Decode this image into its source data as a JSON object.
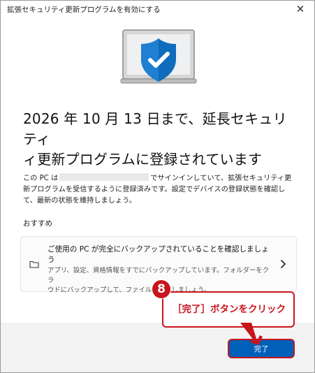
{
  "window": {
    "title": "拡張セキュリティ更新プログラムを有効にする",
    "close_glyph": "✕"
  },
  "headline": {
    "line1": "2026 年 10 月 13 日まで、延長セキュリティ",
    "line2": "ィ更新プログラムに登録されています"
  },
  "body": {
    "line1_prefix": "この PC は",
    "line1_suffix": "でサインインしていて、拡張セキュリティ更",
    "line2": "新プログラムを受信するように登録済みです。設定でデバイスの登録状態を確認し",
    "line3": "て、最新の状態を維持しましょう。"
  },
  "recommend": {
    "label": "おすすめ",
    "card": {
      "title_line1": "ご使用の PC が完全にバックアップされていることを確認しましょ",
      "title_line2": "う",
      "desc_line1": "アプリ、設定、資格情報をすでにバックアップしています。フォルダーをクラ",
      "desc_line2": "ウドにバックアップして、ファイルを保護しましょう。",
      "icon": "folder-icon",
      "chevron": "chevron-right-icon"
    }
  },
  "footer": {
    "done_label": "完了"
  },
  "annotation": {
    "step_number": "8",
    "callout_text": "［完了］ボタンをクリック",
    "color": "#c9141c"
  },
  "colors": {
    "accent": "#005fb8",
    "shield": "#0f6cbd",
    "annotation": "#c9141c"
  }
}
